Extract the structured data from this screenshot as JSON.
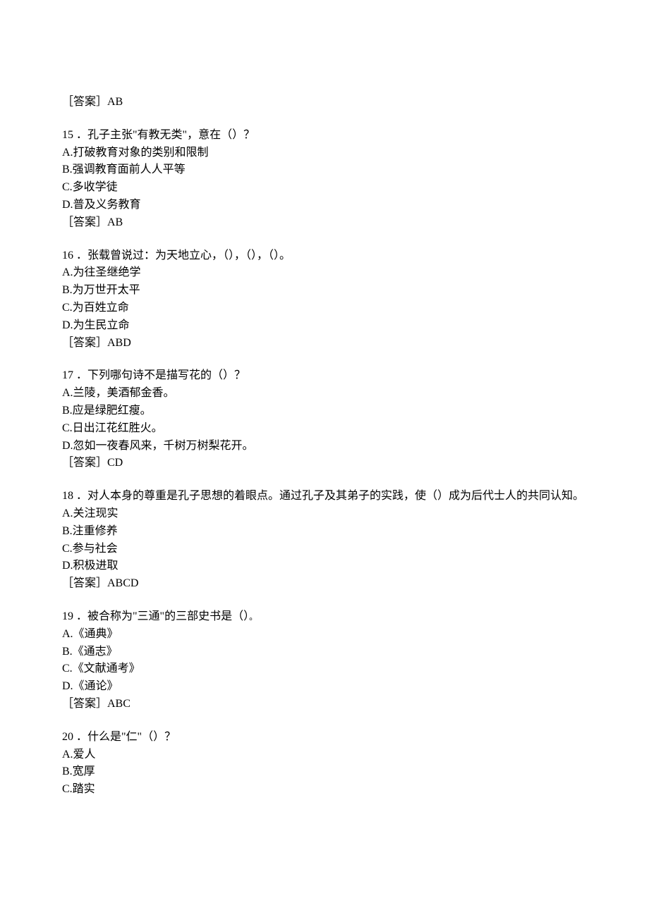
{
  "prev_answer": "［答案］AB",
  "questions": [
    {
      "num": "15",
      "stem": "15 ．孔子主张\"有教无类\"，意在（）？",
      "options": [
        "A.打破教育对象的类别和限制",
        "B.强调教育面前人人平等",
        "C.多收学徒",
        "D.普及义务教育"
      ],
      "answer": "［答案］AB"
    },
    {
      "num": "16",
      "stem": "16 ．张载曾说过：为天地立心，（），（），（）。",
      "options": [
        "A.为往圣继绝学",
        "B.为万世开太平",
        "C.为百姓立命",
        "D.为生民立命"
      ],
      "answer": "［答案］ABD"
    },
    {
      "num": "17",
      "stem": "17 ．下列哪句诗不是描写花的（）？",
      "options": [
        "A.兰陵，美酒郁金香。",
        "B.应是绿肥红瘦。",
        "C.日出江花红胜火。",
        "D.忽如一夜春风来，千树万树梨花开。"
      ],
      "answer": "［答案］CD"
    },
    {
      "num": "18",
      "stem": "18 ．对人本身的尊重是孔子思想的着眼点。通过孔子及其弟子的实践，使（）成为后代士人的共同认知。",
      "options": [
        "A.关注现实",
        "B.注重修养",
        "C.参与社会",
        "D.积极进取"
      ],
      "answer": "［答案］ABCD"
    },
    {
      "num": "19",
      "stem_prefix": "19 ．被合称为\"三通\"的三部史书是（）",
      "stem_suffix": "。",
      "options": [
        "A.《通典》",
        "B.《通志》",
        "C.《文献通考》",
        "D.《通论》"
      ],
      "answer": "［答案］ABC"
    },
    {
      "num": "20",
      "stem": "20 ．什么是\"仁\"（）？",
      "options": [
        "A.爱人",
        "B.宽厚",
        "C.踏实"
      ],
      "answer": null
    }
  ]
}
